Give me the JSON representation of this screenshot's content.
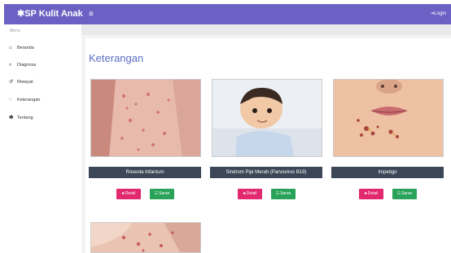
{
  "app": {
    "brand": "✱SP Kulit Anak",
    "menu_icon": "≡",
    "login_label": "⇥Login"
  },
  "sidebar": {
    "heading": "Menu",
    "items": [
      {
        "label": "Beranda",
        "icon": "home-icon",
        "glyph": "⌂"
      },
      {
        "label": "Diagnosa",
        "icon": "search-icon",
        "glyph": "⌕"
      },
      {
        "label": "Riwayat",
        "icon": "history-icon",
        "glyph": "↺"
      },
      {
        "label": "Keterangan",
        "icon": "comment-icon",
        "glyph": "◌"
      },
      {
        "label": "Tentang",
        "icon": "info-icon",
        "glyph": "❶"
      }
    ]
  },
  "main": {
    "title": "Keterangan",
    "detail_label": "Detail",
    "saran_label": "Saran",
    "cards": [
      {
        "name": "Roseola Infantum",
        "image": "rash-back-photo"
      },
      {
        "name": "Sindrom Pipi Merah (Parvovirus B19)",
        "image": "baby-photo"
      },
      {
        "name": "Impetigo",
        "image": "mouth-lesion-photo"
      },
      {
        "name": "",
        "image": "rash-arm-photo"
      }
    ]
  },
  "colors": {
    "topbar": "#6c60c4",
    "title": "#5a6fc6",
    "caption": "#3b4657",
    "detail": "#e2286e",
    "saran": "#29a35a"
  }
}
